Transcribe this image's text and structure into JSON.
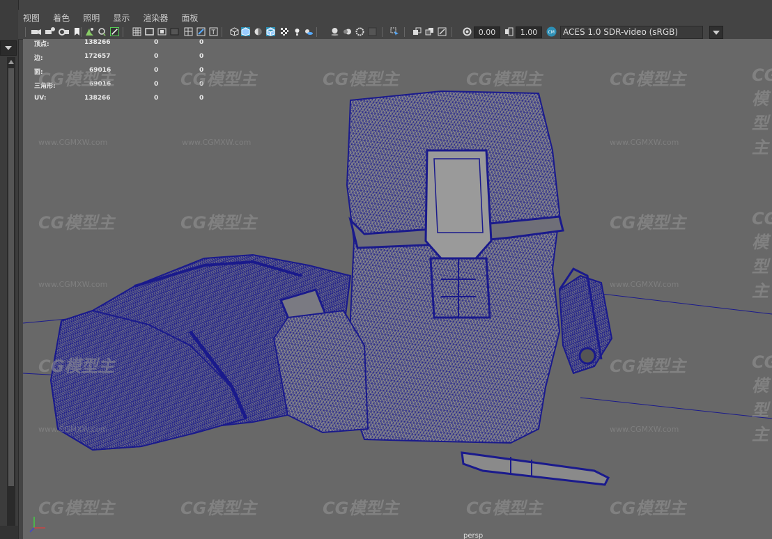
{
  "menu": [
    "视图",
    "着色",
    "照明",
    "显示",
    "渲染器",
    "面板"
  ],
  "toolbar": {
    "icons": [
      "camera-select-icon",
      "camera-attr-icon",
      "bookmark-icon",
      "image-plane-icon",
      "2d-pan-icon",
      "grease-pencil-icon",
      "grid-icon",
      "film-gate-icon",
      "resolution-gate-icon",
      "gate-mask-icon",
      "field-chart-icon",
      "safe-action-icon",
      "safe-title-icon",
      "wireframe-icon",
      "smooth-shade-icon",
      "default-material-icon",
      "wireframe-on-shaded-icon",
      "xray-icon",
      "use-lights-icon",
      "shadows-icon",
      "ambient-occlusion-icon",
      "motion-blur-icon",
      "antialias-icon",
      "depth-of-field-icon",
      "isolate-select-icon",
      "two-sided-icon",
      "backface-icon",
      "exposure-icon",
      "gamma-icon",
      "color-manage-icon"
    ],
    "exposure_value": "0.00",
    "gamma_value": "1.00",
    "color_space": "ACES 1.0 SDR-video (sRGB)"
  },
  "hud": [
    {
      "label": "顶点:",
      "v1": "138266",
      "v2": "0",
      "v3": "0"
    },
    {
      "label": "边:",
      "v1": "172657",
      "v2": "0",
      "v3": "0"
    },
    {
      "label": "面:",
      "v1": "69016",
      "v2": "0",
      "v3": "0"
    },
    {
      "label": "三角形:",
      "v1": "69016",
      "v2": "0",
      "v3": "0"
    },
    {
      "label": "UV:",
      "v1": "138266",
      "v2": "0",
      "v3": "0"
    }
  ],
  "camera_label": "persp",
  "watermark": {
    "logo": "CG模型主",
    "url": "www.CGMXW.com"
  },
  "colors": {
    "wire": "#1a1a8c",
    "mesh": "#8a8a8a",
    "viewport": "#686868",
    "accent": "#2d8fb5"
  }
}
